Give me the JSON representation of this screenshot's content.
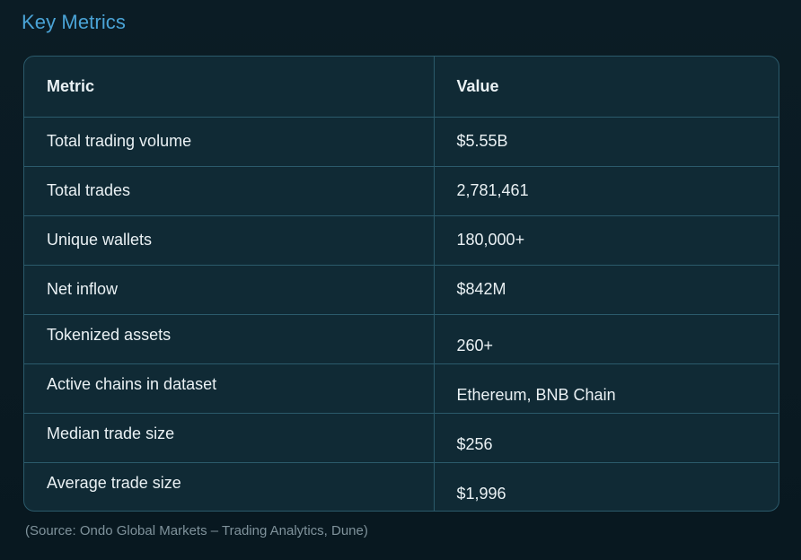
{
  "heading": "Key Metrics",
  "table": {
    "headers": [
      "Metric",
      "Value"
    ],
    "rows": [
      {
        "metric": "Total trading volume",
        "value": "$5.55B"
      },
      {
        "metric": "Total trades",
        "value": "2,781,461"
      },
      {
        "metric": "Unique wallets",
        "value": "180,000+"
      },
      {
        "metric": "Net inflow",
        "value": "$842M"
      },
      {
        "metric": "Tokenized assets",
        "value": "260+"
      },
      {
        "metric": "Active chains in dataset",
        "value": "Ethereum, BNB Chain"
      },
      {
        "metric": "Median trade size",
        "value": "$256"
      },
      {
        "metric": "Average trade size",
        "value": "$1,996"
      }
    ]
  },
  "source": "(Source: Ondo Global Markets – Trading Analytics, Dune)",
  "colors": {
    "heading": "#4aa3d6",
    "table_bg": "#102a35",
    "border": "#2b5a6b"
  }
}
